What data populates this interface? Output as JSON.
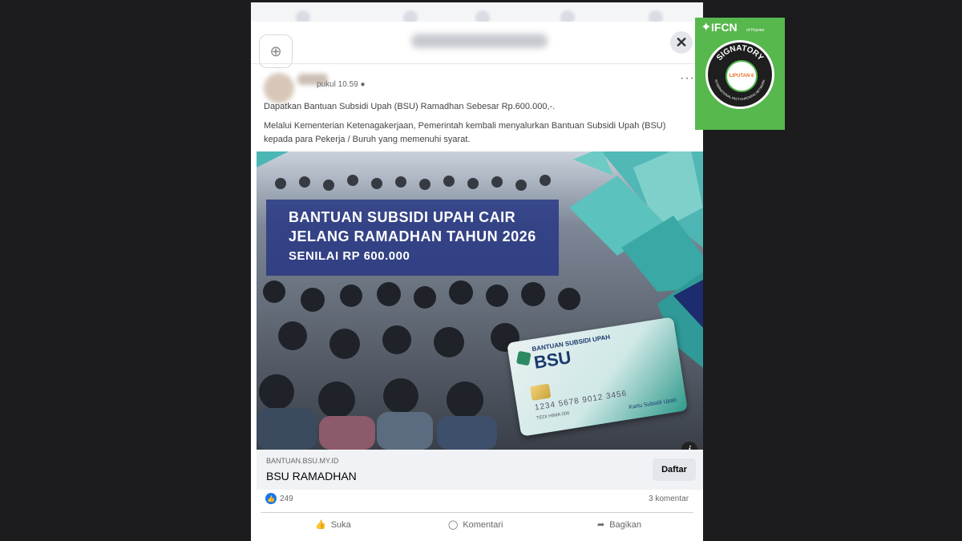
{
  "post": {
    "meta_time": "pukul 10.59",
    "text_line1": "Dapatkan Bantuan Subsidi Upah (BSU) Ramadhan Sebesar Rp.600.000,-.",
    "text_para": "Melalui Kementerian Ketenagakerjaan, Pemerintah kembali menyalurkan Bantuan Subsidi Upah (BSU) kepada para Pekerja / Buruh yang memenuhi syarat.",
    "more": "···"
  },
  "banner": {
    "headline1": "BANTUAN SUBSIDI UPAH CAIR",
    "headline2": "JELANG RAMADHAN TAHUN 2026",
    "price": "SENILAI RP 600.000",
    "card_small": "BANTUAN SUBSIDI UPAH",
    "card_big": "BSU",
    "card_number": "1234 5678 9012 3456",
    "card_name": "TEDI HIMA 000",
    "card_footer": "Kartu Subsidi Upah",
    "info": "i"
  },
  "link": {
    "domain": "BANTUAN.BSU.MY.ID",
    "title": "BSU RAMADHAN",
    "button": "Daftar"
  },
  "reactions": {
    "likes": "249",
    "comments": "3 komentar"
  },
  "actions": {
    "like": "Suka",
    "comment": "Komentari",
    "share": "Bagikan"
  },
  "badge": {
    "ifcn": "IFCN",
    "poynter": "of Poynter",
    "signatory": "SIGNATORY",
    "network": "INTERNATIONAL FACT-CHECKING NETWORK",
    "liputan": "LIPUTAN 6"
  },
  "colors": {
    "facebook_blue": "#1877f2",
    "banner_blue": "#243482",
    "badge_green": "#56b84d",
    "teal": "#4bb7b4"
  }
}
